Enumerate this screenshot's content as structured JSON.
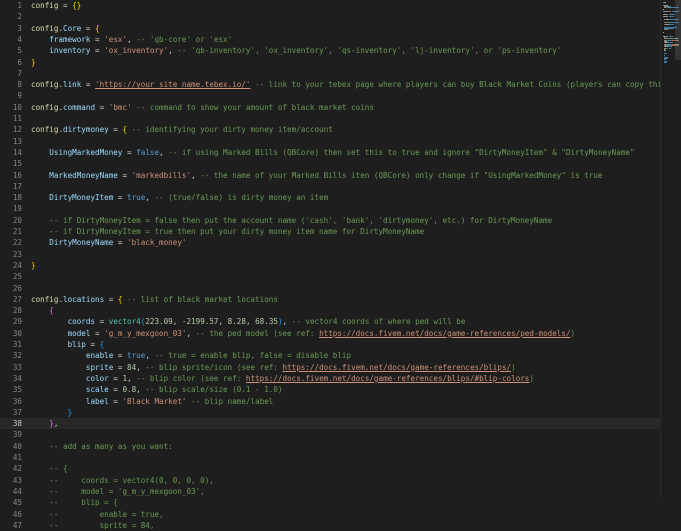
{
  "lines": [
    [
      [
        "k",
        "config"
      ],
      [
        "o",
        " = "
      ],
      [
        "br1",
        "{}"
      ]
    ],
    [],
    [
      [
        "k",
        "config"
      ],
      [
        "o",
        "."
      ],
      [
        "p",
        "Core"
      ],
      [
        "o",
        " = "
      ],
      [
        "br1",
        "{"
      ]
    ],
    [
      [
        "o",
        "    "
      ],
      [
        "p",
        "framework"
      ],
      [
        "o",
        " = "
      ],
      [
        "s",
        "'esx'"
      ],
      [
        "o",
        ", "
      ],
      [
        "c",
        "-- 'qb-core' or 'esx'"
      ]
    ],
    [
      [
        "o",
        "    "
      ],
      [
        "p",
        "inventory"
      ],
      [
        "o",
        " = "
      ],
      [
        "s",
        "'ox_inventory'"
      ],
      [
        "o",
        ", "
      ],
      [
        "c",
        "-- 'qb-inventory', 'ox_inventory', 'qs-inventory', 'lj-inventory', or 'ps-inventory'"
      ]
    ],
    [
      [
        "br1",
        "}"
      ]
    ],
    [],
    [
      [
        "k",
        "config"
      ],
      [
        "o",
        "."
      ],
      [
        "p",
        "link"
      ],
      [
        "o",
        " = "
      ],
      [
        "u",
        "'https://your_site_name.tebex.io/'"
      ],
      [
        "o",
        " "
      ],
      [
        "c",
        "-- link to your tebex page where players can buy Black Market Coins (players can copy this link i"
      ]
    ],
    [],
    [
      [
        "k",
        "config"
      ],
      [
        "o",
        "."
      ],
      [
        "p",
        "command"
      ],
      [
        "o",
        " = "
      ],
      [
        "s",
        "'bmc'"
      ],
      [
        "o",
        " "
      ],
      [
        "c",
        "-- command to show your amount of black market coins"
      ]
    ],
    [],
    [
      [
        "k",
        "config"
      ],
      [
        "o",
        "."
      ],
      [
        "p",
        "dirtymoney"
      ],
      [
        "o",
        " = "
      ],
      [
        "br1",
        "{"
      ],
      [
        "o",
        " "
      ],
      [
        "c",
        "-- identifying your dirty money item/account"
      ]
    ],
    [],
    [
      [
        "o",
        "    "
      ],
      [
        "p",
        "UsingMarkedMoney"
      ],
      [
        "o",
        " = "
      ],
      [
        "b",
        "false"
      ],
      [
        "o",
        ", "
      ],
      [
        "c",
        "-- if using Marked Bills (QBCore) then set this to true and ignore \"DirtyMoneyItem\" & \"DirtyMoneyName\""
      ]
    ],
    [],
    [
      [
        "o",
        "    "
      ],
      [
        "p",
        "MarkedMoneyName"
      ],
      [
        "o",
        " = "
      ],
      [
        "s",
        "'markedbills'"
      ],
      [
        "o",
        ", "
      ],
      [
        "c",
        "-- the name of your Marked Bills iten (QBCore) only change if \"UsingMarkedMoney\" is true"
      ]
    ],
    [],
    [
      [
        "o",
        "    "
      ],
      [
        "p",
        "DirtyMoneyItem"
      ],
      [
        "o",
        " = "
      ],
      [
        "b",
        "true"
      ],
      [
        "o",
        ", "
      ],
      [
        "c",
        "-- (true/false) is dirty money an item"
      ]
    ],
    [],
    [
      [
        "o",
        "    "
      ],
      [
        "c",
        "-- if DirtyMoneyItem = false then put the account name ('cash', 'bank', 'dirtymoney', etc.) for DirtyMoneyName"
      ]
    ],
    [
      [
        "o",
        "    "
      ],
      [
        "c",
        "-- if DirtyMoneyItem = true then put your dirty money item name for DirtyMoneyName"
      ]
    ],
    [
      [
        "o",
        "    "
      ],
      [
        "p",
        "DirtyMoneyName"
      ],
      [
        "o",
        " = "
      ],
      [
        "s",
        "'black_money'"
      ]
    ],
    [],
    [
      [
        "br1",
        "}"
      ]
    ],
    [],
    [],
    [
      [
        "k",
        "config"
      ],
      [
        "o",
        "."
      ],
      [
        "p",
        "locations"
      ],
      [
        "o",
        " = "
      ],
      [
        "br1",
        "{"
      ],
      [
        "o",
        " "
      ],
      [
        "c",
        "-- list of black market locations"
      ]
    ],
    [
      [
        "o",
        "    "
      ],
      [
        "br2",
        "{"
      ]
    ],
    [
      [
        "o",
        "        "
      ],
      [
        "p",
        "coords"
      ],
      [
        "o",
        " = "
      ],
      [
        "f",
        "vector4"
      ],
      [
        "br3",
        "("
      ],
      [
        "n",
        "223.09"
      ],
      [
        "o",
        ", "
      ],
      [
        "n",
        "-2199.57"
      ],
      [
        "o",
        ", "
      ],
      [
        "n",
        "8.28"
      ],
      [
        "o",
        ", "
      ],
      [
        "n",
        "68.35"
      ],
      [
        "br3",
        ")"
      ],
      [
        "o",
        ", "
      ],
      [
        "c",
        "-- vector4 coords of where ped will be"
      ]
    ],
    [
      [
        "o",
        "        "
      ],
      [
        "p",
        "model"
      ],
      [
        "o",
        " = "
      ],
      [
        "s",
        "'g_m_y_mexgoon_03'"
      ],
      [
        "o",
        ", "
      ],
      [
        "c",
        "-- the ped model (see ref: "
      ],
      [
        "u",
        "https://docs.fivem.net/docs/game-references/ped-models/"
      ],
      [
        "c",
        ")"
      ]
    ],
    [
      [
        "o",
        "        "
      ],
      [
        "p",
        "blip"
      ],
      [
        "o",
        " = "
      ],
      [
        "br3",
        "{"
      ]
    ],
    [
      [
        "o",
        "            "
      ],
      [
        "p",
        "enable"
      ],
      [
        "o",
        " = "
      ],
      [
        "b",
        "true"
      ],
      [
        "o",
        ", "
      ],
      [
        "c",
        "-- true = enable blip, false = disable blip"
      ]
    ],
    [
      [
        "o",
        "            "
      ],
      [
        "p",
        "sprite"
      ],
      [
        "o",
        " = "
      ],
      [
        "n",
        "84"
      ],
      [
        "o",
        ", "
      ],
      [
        "c",
        "-- blip sprite/icon (see ref: "
      ],
      [
        "u",
        "https://docs.fivem.net/docs/game-references/blips/"
      ],
      [
        "c",
        ")"
      ]
    ],
    [
      [
        "o",
        "            "
      ],
      [
        "p",
        "color"
      ],
      [
        "o",
        " = "
      ],
      [
        "n",
        "1"
      ],
      [
        "o",
        ", "
      ],
      [
        "c",
        "-- blip color (see ref: "
      ],
      [
        "u",
        "https://docs.fivem.net/docs/game-references/blips/#blip-colors"
      ],
      [
        "c",
        ")"
      ]
    ],
    [
      [
        "o",
        "            "
      ],
      [
        "p",
        "scale"
      ],
      [
        "o",
        " = "
      ],
      [
        "n",
        "0.8"
      ],
      [
        "o",
        ", "
      ],
      [
        "c",
        "-- blip scale/size (0.1 - 1.0)"
      ]
    ],
    [
      [
        "o",
        "            "
      ],
      [
        "p",
        "label"
      ],
      [
        "o",
        " = "
      ],
      [
        "s",
        "'Black Market'"
      ],
      [
        "o",
        " "
      ],
      [
        "c",
        "-- blip name/label"
      ]
    ],
    [
      [
        "o",
        "        "
      ],
      [
        "br3",
        "}"
      ]
    ],
    [
      [
        "o",
        "    "
      ],
      [
        "br2",
        "}"
      ],
      [
        "o",
        ","
      ]
    ],
    [],
    [
      [
        "o",
        "    "
      ],
      [
        "c",
        "-- add as many as you want:"
      ]
    ],
    [],
    [
      [
        "o",
        "    "
      ],
      [
        "c",
        "-- {"
      ]
    ],
    [
      [
        "o",
        "    "
      ],
      [
        "c",
        "--     coords = vector4(0, 0, 0, 0),"
      ]
    ],
    [
      [
        "o",
        "    "
      ],
      [
        "c",
        "--     model = 'g_m_y_mexgoon_03',"
      ]
    ],
    [
      [
        "o",
        "    "
      ],
      [
        "c",
        "--     blip = {"
      ]
    ],
    [
      [
        "o",
        "    "
      ],
      [
        "c",
        "--         enable = true,"
      ]
    ],
    [
      [
        "o",
        "    "
      ],
      [
        "c",
        "--         sprite = 84,"
      ]
    ]
  ],
  "current_line": 38,
  "colors": {
    "background": "#1e1e1e",
    "line_number": "#858585",
    "keyword": "#dcdcaa",
    "property": "#9cdcfe",
    "string": "#ce9178",
    "comment": "#6a9955",
    "number": "#b5cea8",
    "boolean": "#569cd6"
  }
}
